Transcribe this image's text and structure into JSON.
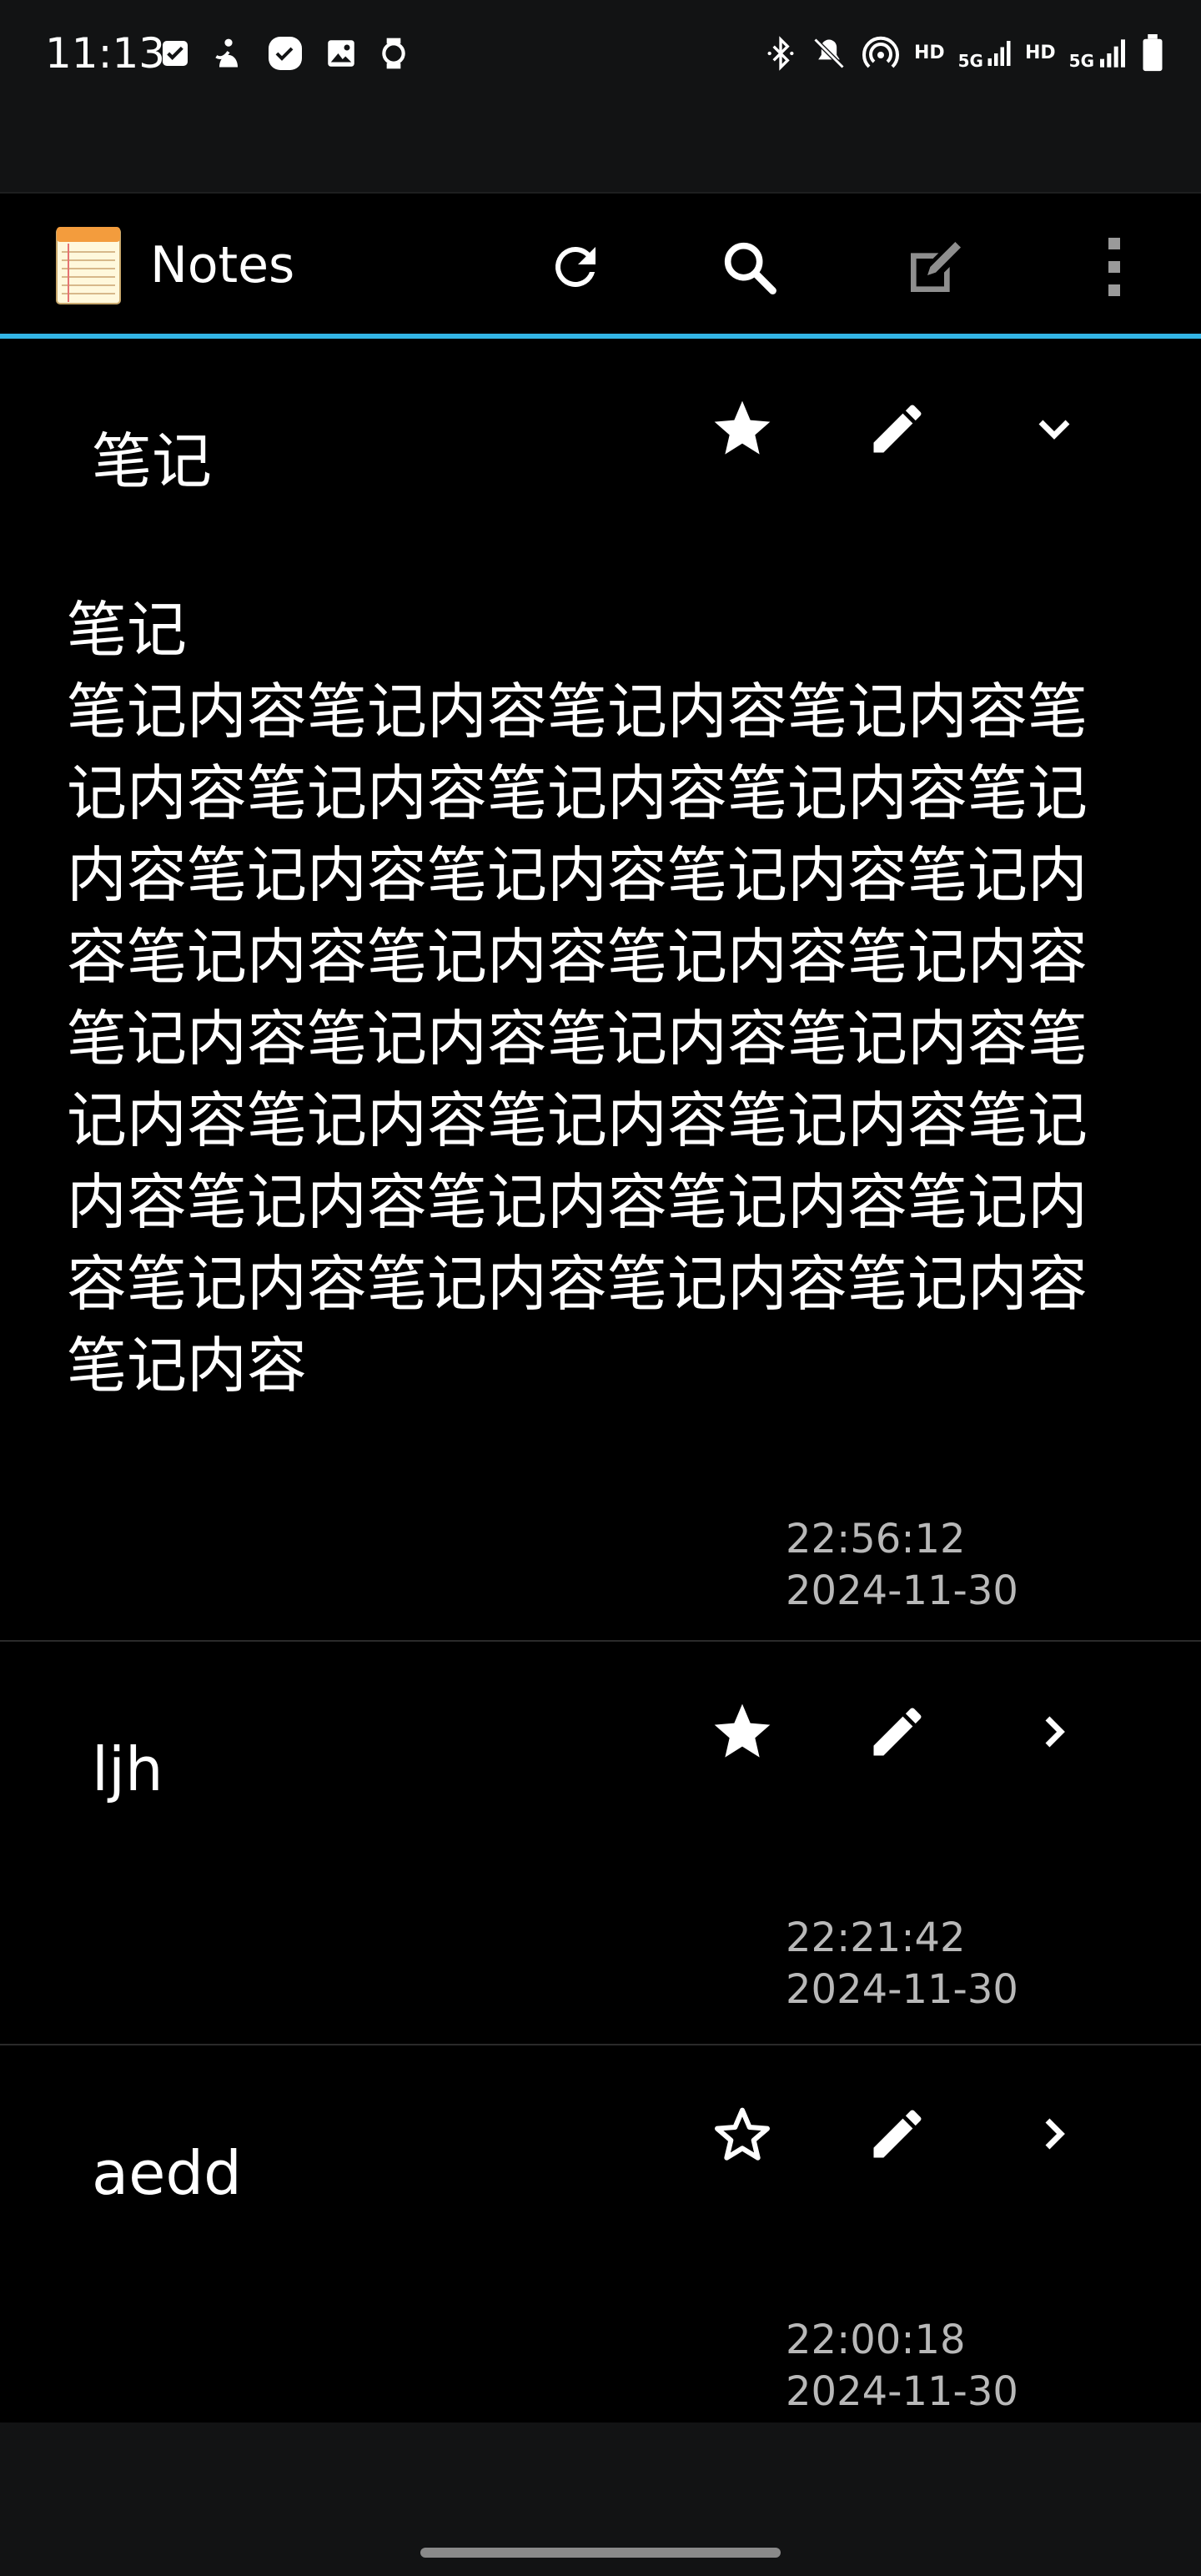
{
  "status_bar": {
    "time": "11:13",
    "left_icons": [
      "checkbox-icon",
      "accessibility-icon",
      "dialer-icon",
      "image-icon",
      "watch-icon"
    ],
    "right_icons": [
      "bluetooth-icon",
      "mute-icon",
      "hotspot-icon",
      "signal-icon",
      "signal-icon",
      "battery-icon"
    ],
    "net_labels": [
      "HD",
      "5G",
      "HD",
      "5G"
    ]
  },
  "app_bar": {
    "title": "Notes",
    "accent_color": "#33b5e5",
    "actions": [
      "refresh-icon",
      "search-icon",
      "new-note-icon",
      "overflow-menu-icon"
    ]
  },
  "notes": [
    {
      "title": "笔记",
      "starred": true,
      "expanded": true,
      "content": "笔记\n笔记内容笔记内容笔记内容笔记内容笔记内容笔记内容笔记内容笔记内容笔记内容笔记内容笔记内容笔记内容笔记内容笔记内容笔记内容笔记内容笔记内容笔记内容笔记内容笔记内容笔记内容笔记内容笔记内容笔记内容笔记内容笔记内容笔记内容笔记内容笔记内容笔记内容笔记内容笔记内容笔记内容笔记内容笔记内容",
      "time": "22:56:12",
      "date": "2024-11-30"
    },
    {
      "title": "ljh",
      "starred": true,
      "expanded": false,
      "content": "",
      "time": "22:21:42",
      "date": "2024-11-30"
    },
    {
      "title": "aedd",
      "starred": false,
      "expanded": false,
      "content": "",
      "time": "22:00:18",
      "date": "2024-11-30"
    }
  ]
}
